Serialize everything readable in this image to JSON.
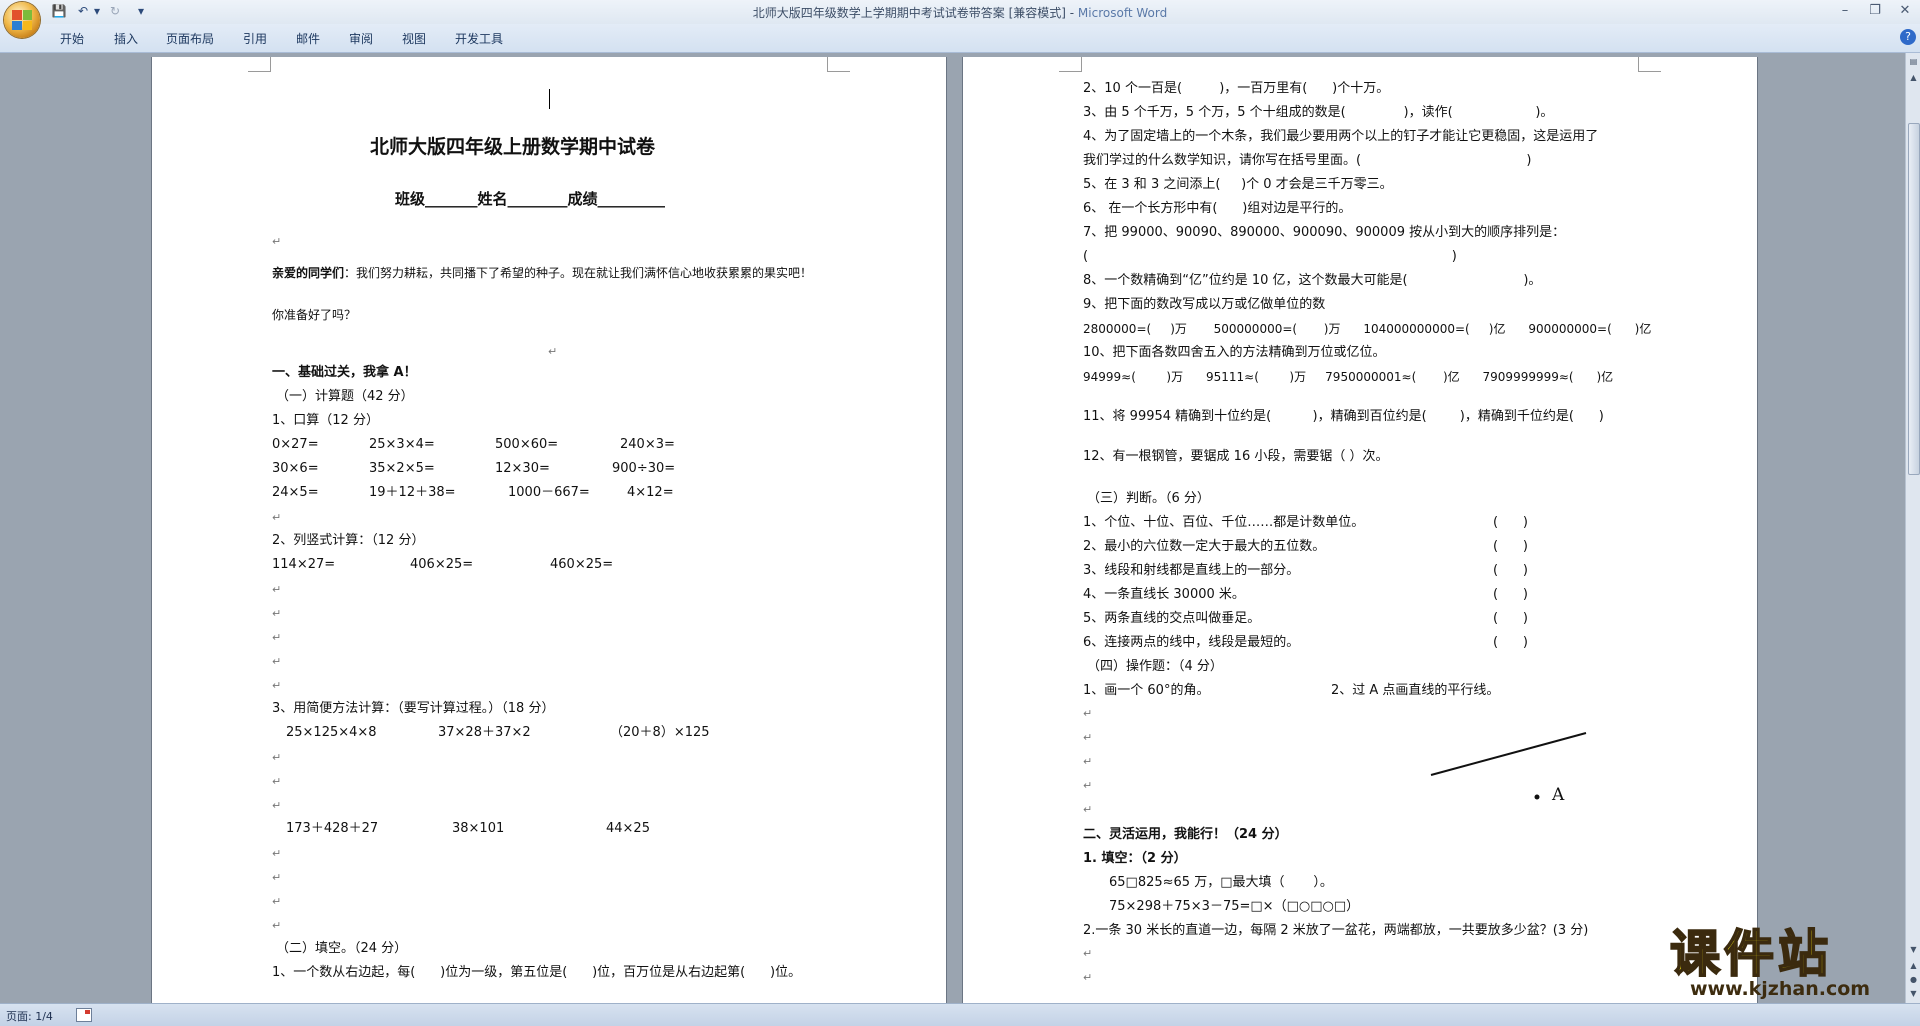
{
  "window": {
    "title": "北师大版四年级数学上学期期中考试试卷带答案 [兼容模式] - ",
    "app_name": "Microsoft Word",
    "minimize": "–",
    "restore": "❐",
    "close": "✕"
  },
  "qat": {
    "save": "💾",
    "undo": "↶",
    "redo": "↻",
    "more": "▾"
  },
  "ribbon": {
    "tabs": [
      "开始",
      "插入",
      "页面布局",
      "引用",
      "邮件",
      "审阅",
      "视图",
      "开发工具"
    ],
    "help": "?"
  },
  "statusbar": {
    "page": "页面: 1/4"
  },
  "page1": {
    "title": "北师大版四年级上册数学期中试卷",
    "info": "班级_______姓名________成绩_________",
    "greet_bold": "亲爱的同学们",
    "greet_text": "：我们努力耕耘，共同播下了希望的种子。现在就让我们满怀信心地收获累累的果实吧！",
    "ready": "你准备好了吗？",
    "sec1": "一、基础过关，我拿 A！",
    "sub1": "（一）计算题（42 分）",
    "q1": "1、口算（12 分）",
    "oral_rows": [
      [
        "0×27=",
        "25×3×4=",
        "500×60=",
        "240×3="
      ],
      [
        "30×6=",
        "35×2×5=",
        "12×30=",
        "900÷30="
      ],
      [
        "24×5=",
        "19＋12＋38=",
        "1000－667=",
        "4×12="
      ]
    ],
    "q2": "2、列竖式计算：（12 分）",
    "vert": [
      "114×27=",
      "406×25=",
      "460×25="
    ],
    "q3": "3、用简便方法计算：（要写计算过程。）（18 分）",
    "simp1": [
      "25×125×4×8",
      "37×28＋37×2",
      "（20＋8）×125"
    ],
    "simp2": [
      "173＋428＋27",
      "38×101",
      "44×25"
    ],
    "sub2": "（二）填空。（24 分）",
    "fill1": "1、一个数从右边起，每(      )位为一级，第五位是(      )位，百万位是从右边起第(      )位。"
  },
  "page2": {
    "lines": [
      "2、10 个一百是(         )，一百万里有(      )个十万。",
      "3、由 5 个千万，5 个万，5 个十组成的数是(              )，读作(                    )。",
      "4、为了固定墙上的一个木条，我们最少要用两个以上的钉子才能让它更稳固，这是运用了",
      "我们学过的什么数学知识，请你写在括号里面。(                                        )",
      "5、在 3 和 3 之间添上(     )个 0 才会是三千万零三。",
      "6、 在一个长方形中有(      )组对边是平行的。",
      "7、把 99000、90090、890000、900090、900009 按从小到大的顺序排列是：",
      "(                                                                                        )",
      "8、一个数精确到“亿”位约是 10 亿，这个数最大可能是(                            )。",
      "9、把下面的数改写成以万或亿做单位的数",
      "2800000=(     )万       500000000=(       )万      104000000000=(     )亿      900000000=(      )亿",
      "10、把下面各数四舍五入的方法精确到万位或亿位。",
      "94999≈(        )万      95111≈(        )万     7950000001≈(       )亿      7909999999≈(      )亿"
    ],
    "q11": "11、将 99954 精确到十位约是(          )，精确到百位约是(        )，精确到千位约是(      )",
    "q12": "12、有一根钢管，要锯成 16 小段，需要锯（ ）次。",
    "judge_title": "（三）判断。（6 分）",
    "judge": [
      "1、个位、十位、百位、千位……都是计数单位。",
      "2、最小的六位数一定大于最大的五位数。",
      "3、线段和射线都是直线上的一部分。",
      "4、一条直线长 30000 米。",
      "5、两条直线的交点叫做垂足。",
      "6、连接两点的线中，线段是最短的。"
    ],
    "judge_paren": "(      )",
    "op_title": "（四）操作题：（4 分）",
    "op1": "1、画一个 60°的角。",
    "op2": "2、过 A 点画直线的平行线。",
    "point_a": "A",
    "sec2": "二、灵活运用，我能行！（24 分）",
    "fill_title": "1. 填空：（2 分）",
    "fill_a": "65□825≈65 万，□最大填（       ）。",
    "fill_b": "75×298＋75×3－75=□×（□○□○□）",
    "q2": "2.一条 30 米长的直道一边，每隔 2 米放了一盆花，两端都放，一共要放多少盆？(3 分)"
  },
  "watermark": {
    "big": "课件站",
    "url": "www.kjzhan.com"
  },
  "colors": {
    "ribbon": "#d4e1f1",
    "docbg": "#9aa4b0",
    "watermark": "#f2e60f"
  }
}
